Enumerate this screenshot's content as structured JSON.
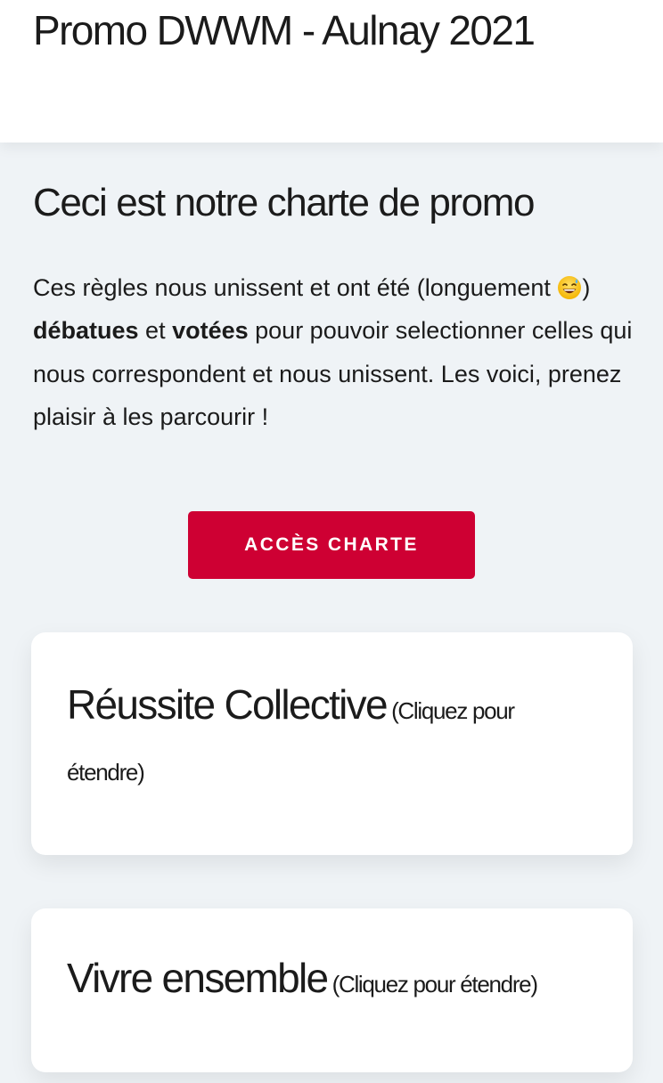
{
  "header": {
    "site_title": "Promo DWWM - Aulnay 2021"
  },
  "intro": {
    "title": "Ceci est notre charte de promo",
    "text_1": "Ces règles nous unissent et ont été (longuement ",
    "emoji": "😅",
    "text_2": ") ",
    "bold_1": "débatues",
    "text_3": " et ",
    "bold_2": "votées",
    "text_4": " pour pouvoir selectionner celles qui nous correspondent et nous unissent. Les voici, prenez plaisir à les parcourir !"
  },
  "cta": {
    "label": "ACCÈS CHARTE"
  },
  "cards": [
    {
      "title": "Réussite Collective",
      "hint": "(Cliquez pour étendre)"
    },
    {
      "title": "Vivre ensemble",
      "hint": "(Cliquez pour étendre)"
    }
  ],
  "colors": {
    "accent": "#ce0033",
    "background": "#eff3f6",
    "card": "#ffffff",
    "text": "#1b1b1b"
  }
}
